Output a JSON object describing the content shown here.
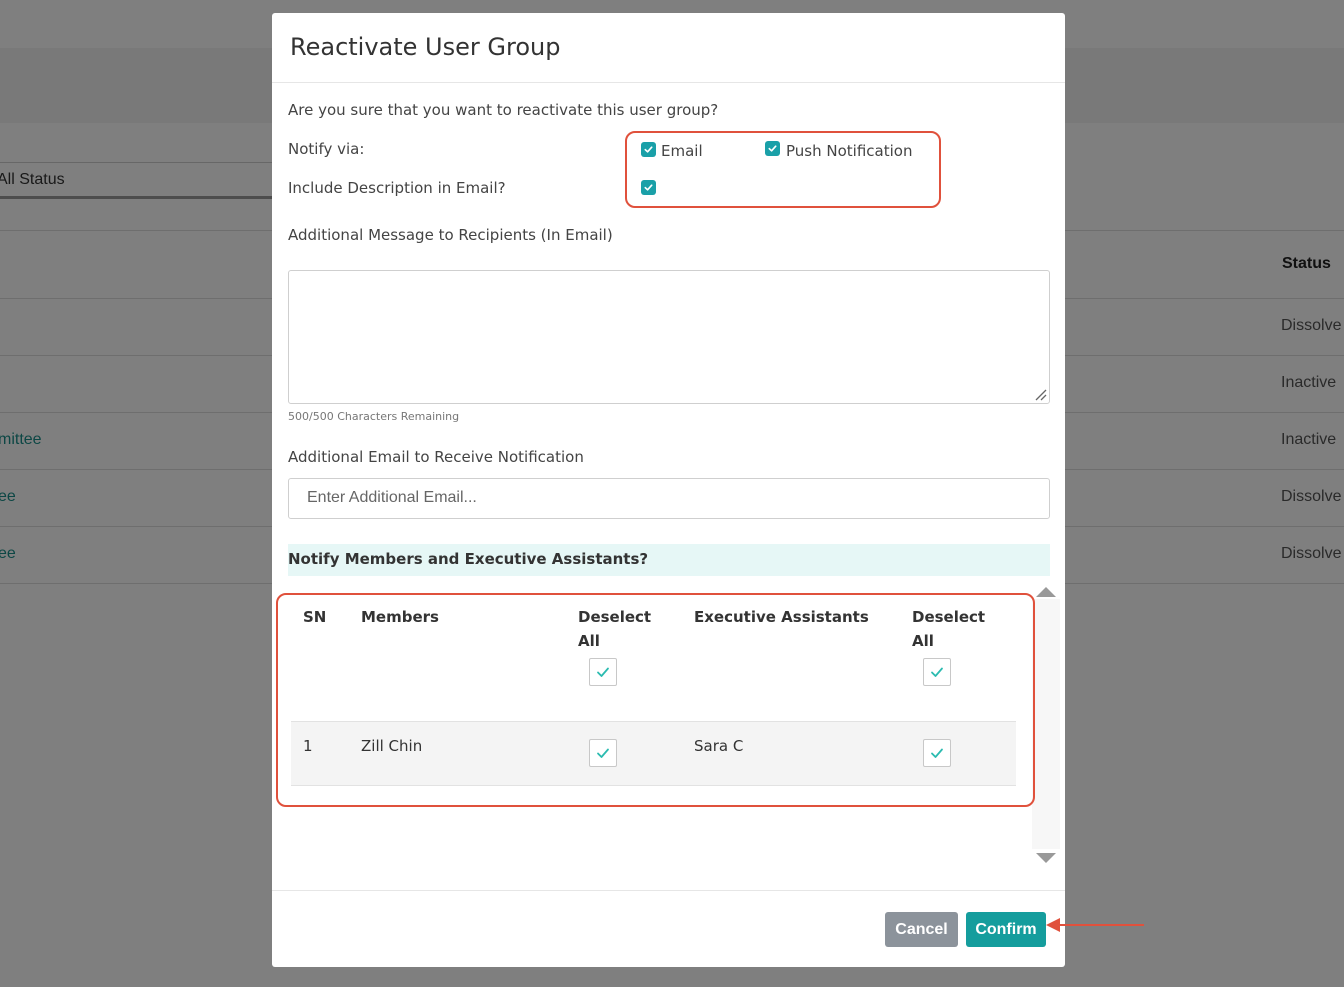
{
  "background": {
    "filter_value": "All Status",
    "status_header": "Status",
    "rows": [
      {
        "link": "",
        "status": "Dissolve"
      },
      {
        "link": "",
        "status": "Inactive"
      },
      {
        "link": "mittee",
        "status": "Inactive"
      },
      {
        "link": "ee",
        "status": "Dissolve"
      },
      {
        "link": "ee",
        "status": "Dissolve"
      }
    ]
  },
  "modal": {
    "title": "Reactivate User Group",
    "question": "Are you sure that you want to reactivate this user group?",
    "notify_via_label": "Notify via:",
    "email_label": "Email",
    "push_label": "Push Notification",
    "include_desc_label": "Include Description in Email?",
    "additional_message_label": "Additional Message to Recipients (In Email)",
    "chars_remaining": "500/500 Characters Remaining",
    "additional_email_label": "Additional Email to Receive Notification",
    "additional_email_placeholder": "Enter Additional Email...",
    "notify_members_label": "Notify Members and Executive Assistants?",
    "table": {
      "headers": {
        "sn": "SN",
        "members": "Members",
        "deselect_all_1": "Deselect",
        "deselect_all_1b": "All",
        "executive_assistants": "Executive Assistants",
        "deselect_all_2": "Deselect",
        "deselect_all_2b": "All"
      },
      "rows": [
        {
          "sn": "1",
          "member": "Zill Chin",
          "assistant": "Sara C"
        }
      ]
    },
    "cancel_label": "Cancel",
    "confirm_label": "Confirm"
  },
  "colors": {
    "accent": "#159d9d",
    "highlight": "#e0513c",
    "cancel": "#8c939b"
  }
}
